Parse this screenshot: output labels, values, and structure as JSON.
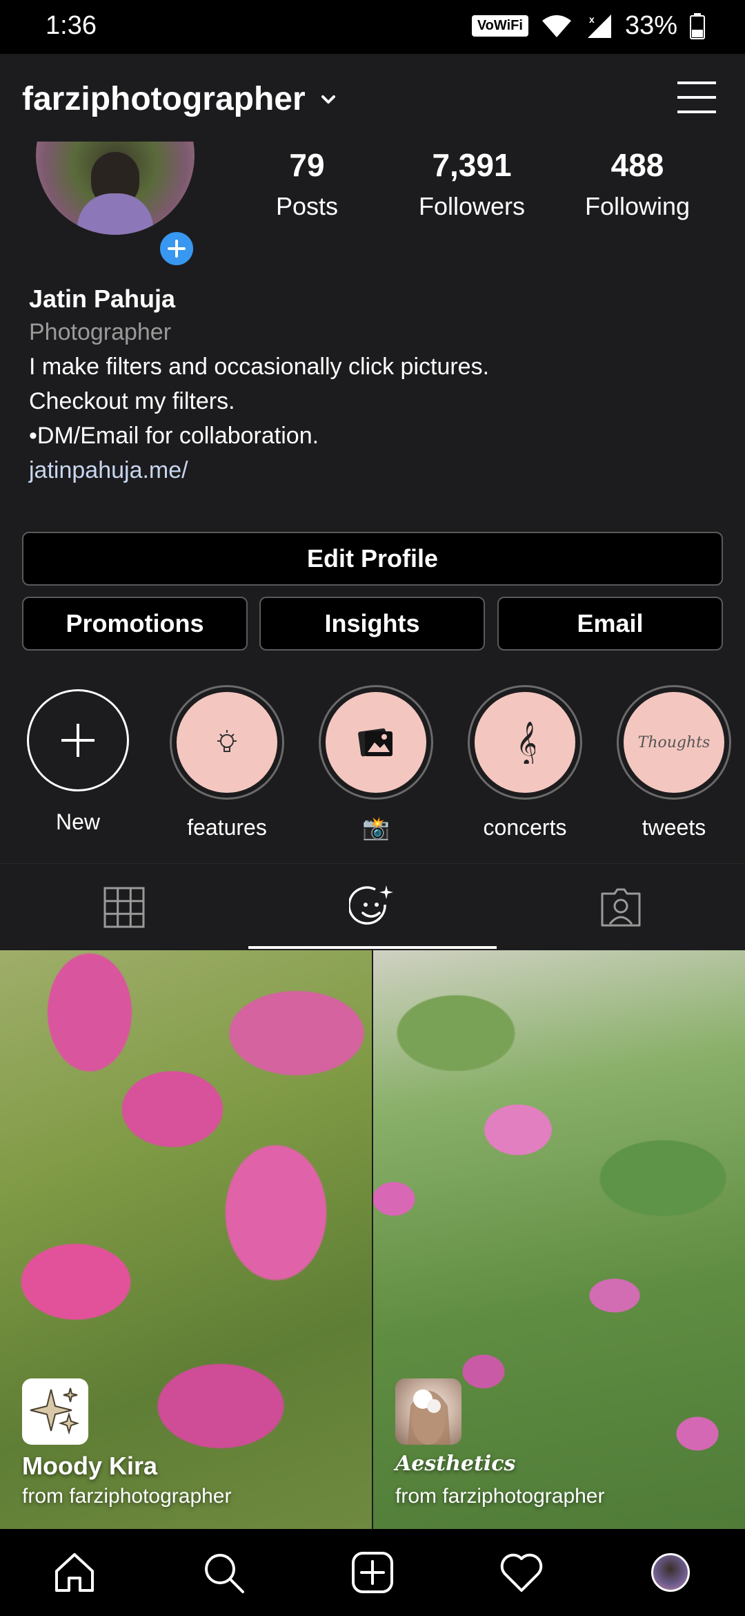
{
  "status_bar": {
    "time": "1:36",
    "vowifi": "VoWiFi",
    "battery": "33%"
  },
  "header": {
    "username": "farziphotographer"
  },
  "profile": {
    "stats": [
      {
        "value": "79",
        "label": "Posts"
      },
      {
        "value": "7,391",
        "label": "Followers"
      },
      {
        "value": "488",
        "label": "Following"
      }
    ],
    "full_name": "Jatin Pahuja",
    "category": "Photographer",
    "bio": [
      "I make filters and occasionally click pictures.",
      "Checkout my filters.",
      "•DM/Email for collaboration."
    ],
    "link": "jatinpahuja.me/"
  },
  "buttons": {
    "edit_profile": "Edit Profile",
    "promotions": "Promotions",
    "insights": "Insights",
    "email": "Email"
  },
  "highlights": [
    {
      "label": "New",
      "icon": "plus-icon"
    },
    {
      "label": "features",
      "icon": "lightbulb-icon"
    },
    {
      "label": "📸",
      "icon": "photos-icon"
    },
    {
      "label": "concerts",
      "icon": "treble-clef-icon"
    },
    {
      "label": "tweets",
      "icon": "thoughts-script-icon",
      "icon_text": "Thoughts"
    }
  ],
  "tabs": [
    {
      "name": "grid",
      "icon": "grid-icon",
      "active": false
    },
    {
      "name": "effects",
      "icon": "effects-face-icon",
      "active": true
    },
    {
      "name": "tagged",
      "icon": "tagged-person-icon",
      "active": false
    }
  ],
  "effects": [
    {
      "name": "Moody Kira",
      "creator": "from farziphotographer",
      "thumb": "sparkle-icon"
    },
    {
      "name": "Aesthetics",
      "creator": "from farziphotographer",
      "thumb": "portrait-photo"
    }
  ],
  "bottom_nav": [
    {
      "name": "home",
      "icon": "home-icon"
    },
    {
      "name": "search",
      "icon": "search-icon"
    },
    {
      "name": "new-post",
      "icon": "add-post-icon"
    },
    {
      "name": "activity",
      "icon": "heart-icon"
    },
    {
      "name": "profile",
      "icon": "profile-avatar"
    }
  ],
  "colors": {
    "background": "#1c1c1e",
    "accent_blue": "#3897f0",
    "highlight_pink": "#f3c7c0",
    "secondary_text": "#9a9a9a"
  }
}
